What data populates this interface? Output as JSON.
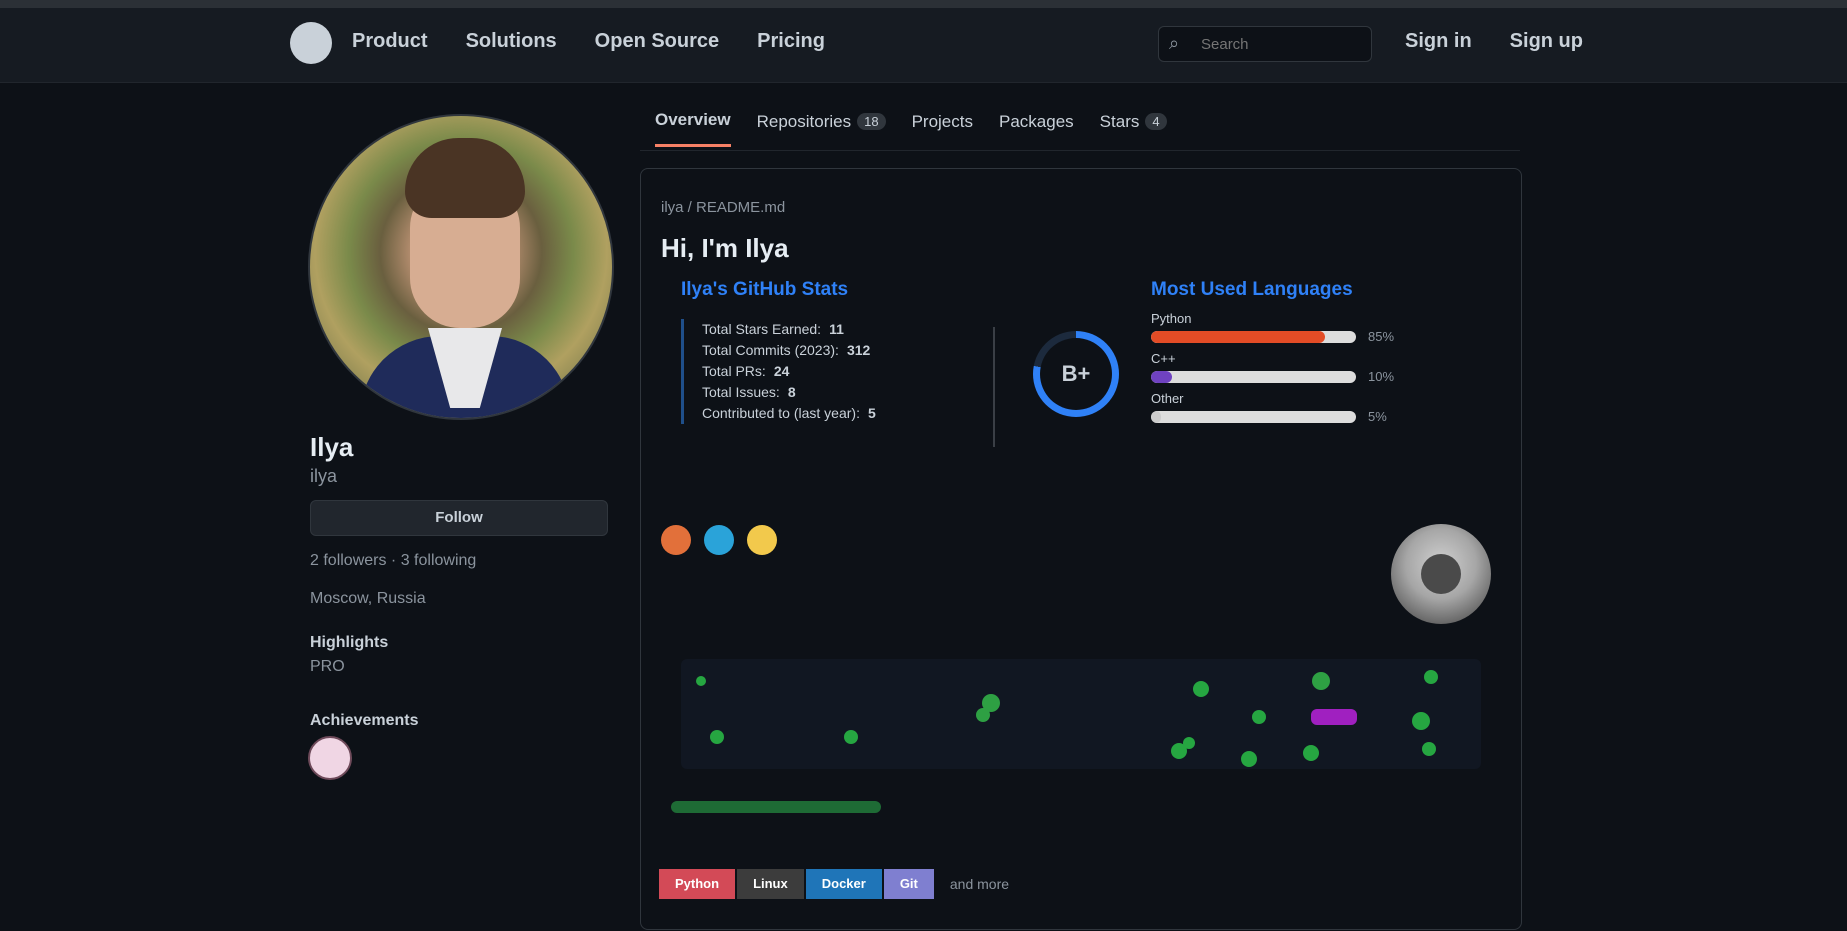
{
  "topbar": {
    "nav": [
      "Product",
      "Solutions",
      "Open Source",
      "Pricing"
    ],
    "search_placeholder": "Search",
    "right_links": [
      "Sign in",
      "Sign up"
    ]
  },
  "profile": {
    "name": "Ilya",
    "login": "ilya",
    "follow_label": "Follow",
    "followers": "2 followers · 3 following",
    "location": "Moscow, Russia",
    "achievements_title": "Achievements",
    "highlights_title": "Highlights",
    "highlight_item": "PRO"
  },
  "tabs": [
    {
      "label": "Overview",
      "count": ""
    },
    {
      "label": "Repositories",
      "count": "18"
    },
    {
      "label": "Projects",
      "count": ""
    },
    {
      "label": "Packages",
      "count": ""
    },
    {
      "label": "Stars",
      "count": "4"
    }
  ],
  "readme": {
    "path": "ilya / README.md",
    "heading": "Hi, I'm Ilya"
  },
  "stats": {
    "title": "Ilya's GitHub Stats",
    "rows": [
      {
        "label": "Total Stars Earned:",
        "value": "11"
      },
      {
        "label": "Total Commits (2023):",
        "value": "312"
      },
      {
        "label": "Total PRs:",
        "value": "24"
      },
      {
        "label": "Total Issues:",
        "value": "8"
      },
      {
        "label": "Contributed to (last year):",
        "value": "5"
      }
    ],
    "rank": "B+",
    "rank_progress": 0.78
  },
  "languages": {
    "title": "Most Used Languages",
    "items": [
      {
        "name": "Python",
        "percent": 85,
        "color": "#e34c26",
        "pct_label": "85%"
      },
      {
        "name": "C++",
        "percent": 10,
        "color": "#6f42c1",
        "pct_label": "10%"
      },
      {
        "name": "Other",
        "percent": 5,
        "color": "#cccccc",
        "pct_label": "5%"
      }
    ]
  },
  "social_badges": [
    {
      "name": "gitlab-icon",
      "color": "#e2703a"
    },
    {
      "name": "telegram-icon",
      "color": "#2aa3d9"
    },
    {
      "name": "yandex-icon",
      "color": "#f2c94c"
    }
  ],
  "skills": [
    {
      "label": "Python",
      "color": "#d34a57"
    },
    {
      "label": "Linux",
      "color": "#3c3c3c"
    },
    {
      "label": "Docker",
      "color": "#1f75b8"
    },
    {
      "label": "Git",
      "color": "#7f7fd0"
    }
  ],
  "skills_more": "and more"
}
